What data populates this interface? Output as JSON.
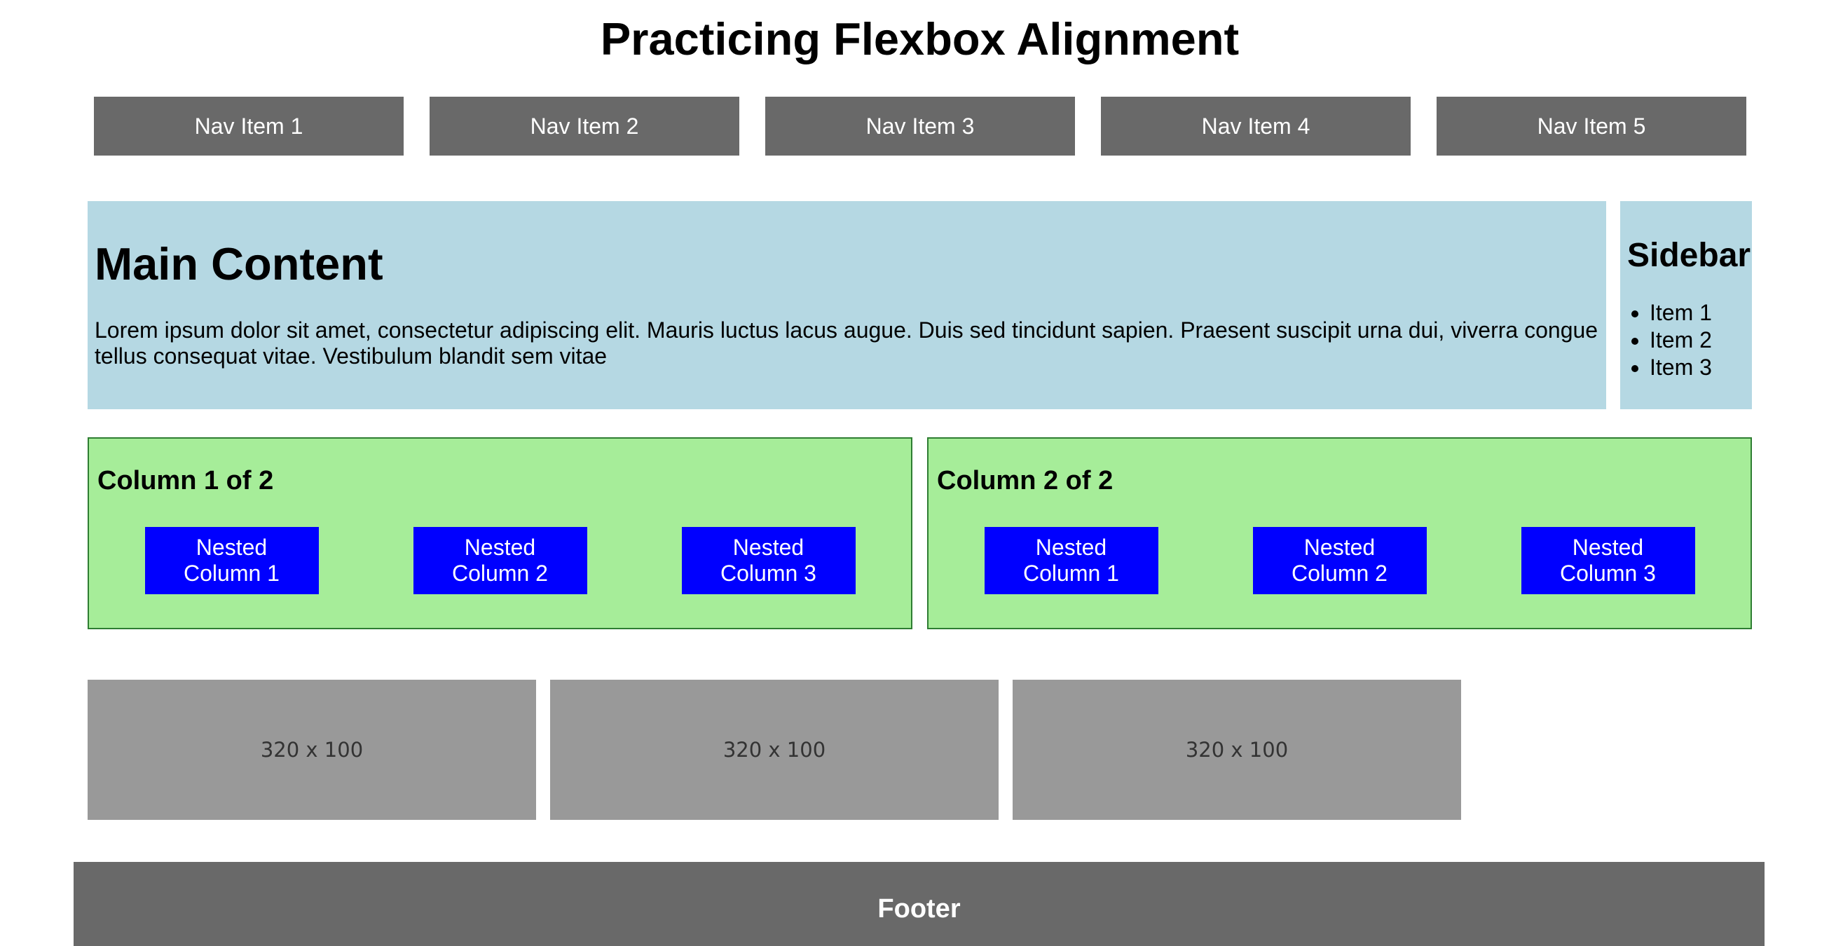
{
  "page": {
    "title": "Practicing Flexbox Alignment"
  },
  "nav": {
    "items": [
      {
        "label": "Nav Item 1"
      },
      {
        "label": "Nav Item 2"
      },
      {
        "label": "Nav Item 3"
      },
      {
        "label": "Nav Item 4"
      },
      {
        "label": "Nav Item 5"
      }
    ]
  },
  "main": {
    "heading": "Main Content",
    "body": "Lorem ipsum dolor sit amet, consectetur adipiscing elit. Mauris luctus lacus augue. Duis sed tincidunt sapien. Praesent suscipit urna dui, viverra congue tellus consequat vitae. Vestibulum blandit sem vitae"
  },
  "sidebar": {
    "heading": "Sidebar",
    "items": [
      "Item 1",
      "Item 2",
      "Item 3"
    ]
  },
  "columns": [
    {
      "heading": "Column 1 of 2",
      "nested": [
        "Nested Column 1",
        "Nested Column 2",
        "Nested Column 3"
      ]
    },
    {
      "heading": "Column 2 of 2",
      "nested": [
        "Nested Column 1",
        "Nested Column 2",
        "Nested Column 3"
      ]
    }
  ],
  "images": [
    {
      "label": "320 x 100"
    },
    {
      "label": "320 x 100"
    },
    {
      "label": "320 x 100"
    }
  ],
  "footer": {
    "text": "Footer"
  },
  "colors": {
    "nav_background": "#696969",
    "content_background": "#b5d8e3",
    "column_background": "#a6ed99",
    "column_border": "#2e7d32",
    "nested_background": "#0000ff",
    "placeholder_background": "#999999",
    "footer_background": "#696969"
  }
}
